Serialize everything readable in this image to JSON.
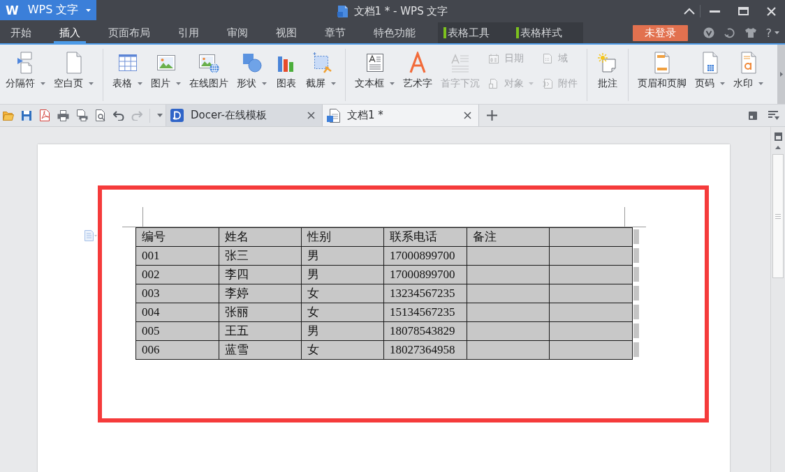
{
  "app_button": {
    "logo": "W",
    "label": "WPS 文字"
  },
  "window": {
    "title": "文档1 * - WPS 文字"
  },
  "menu_tabs": [
    {
      "label": "开始",
      "selected": false,
      "kind": "standard"
    },
    {
      "label": "插入",
      "selected": true,
      "kind": "standard"
    },
    {
      "label": "页面布局",
      "selected": false,
      "kind": "standard"
    },
    {
      "label": "引用",
      "selected": false,
      "kind": "standard"
    },
    {
      "label": "审阅",
      "selected": false,
      "kind": "standard"
    },
    {
      "label": "视图",
      "selected": false,
      "kind": "standard"
    },
    {
      "label": "章节",
      "selected": false,
      "kind": "standard"
    },
    {
      "label": "特色功能",
      "selected": false,
      "kind": "standard"
    },
    {
      "label": "表格工具",
      "selected": false,
      "kind": "context"
    },
    {
      "label": "表格样式",
      "selected": false,
      "kind": "context"
    }
  ],
  "login_button": {
    "label": "未登录"
  },
  "help_button": {
    "label": "?"
  },
  "ribbon": {
    "groups": [
      [
        {
          "label": "分隔符",
          "kind": "large",
          "dropdown": true,
          "disabled": false
        },
        {
          "label": "空白页",
          "kind": "large",
          "dropdown": true,
          "disabled": false
        }
      ],
      [
        {
          "label": "表格",
          "kind": "large",
          "dropdown": true,
          "disabled": false
        },
        {
          "label": "图片",
          "kind": "large",
          "dropdown": true,
          "disabled": false
        },
        {
          "label": "在线图片",
          "kind": "large",
          "dropdown": false,
          "disabled": false
        },
        {
          "label": "形状",
          "kind": "large",
          "dropdown": true,
          "disabled": false
        },
        {
          "label": "图表",
          "kind": "large",
          "dropdown": false,
          "disabled": false
        },
        {
          "label": "截屏",
          "kind": "large",
          "dropdown": true,
          "disabled": false
        }
      ],
      [
        {
          "label": "文本框",
          "kind": "large",
          "dropdown": true,
          "disabled": false
        },
        {
          "label": "艺术字",
          "kind": "large",
          "dropdown": false,
          "disabled": false
        },
        {
          "label": "首字下沉",
          "kind": "large",
          "dropdown": false,
          "disabled": true
        },
        {
          "label": "日期",
          "kind": "small",
          "dropdown": false,
          "disabled": true
        },
        {
          "label": "对象",
          "kind": "small",
          "dropdown": true,
          "disabled": true
        },
        {
          "label": "域",
          "kind": "small",
          "dropdown": false,
          "disabled": true
        },
        {
          "label": "附件",
          "kind": "small",
          "dropdown": false,
          "disabled": true
        }
      ],
      [
        {
          "label": "批注",
          "kind": "large",
          "dropdown": false,
          "disabled": false
        }
      ],
      [
        {
          "label": "页眉和页脚",
          "kind": "large",
          "dropdown": false,
          "disabled": false
        },
        {
          "label": "页码",
          "kind": "large",
          "dropdown": true,
          "disabled": false
        },
        {
          "label": "水印",
          "kind": "large",
          "dropdown": true,
          "disabled": false
        }
      ]
    ]
  },
  "doc_tabs": [
    {
      "label": "Docer-在线模板",
      "selected": false
    },
    {
      "label": "文档1 *",
      "selected": true
    }
  ],
  "table": {
    "selected": true,
    "columns": [
      {
        "label": "编号"
      },
      {
        "label": "姓名"
      },
      {
        "label": "性别"
      },
      {
        "label": "联系电话"
      },
      {
        "label": "备注"
      },
      {}
    ],
    "rows": [
      [
        "001",
        "张三",
        "男",
        "17000899700"
      ],
      [
        "002",
        "李四",
        "男",
        "17000899700"
      ],
      [
        "003",
        "李婷",
        "女",
        "13234567235"
      ],
      [
        "004",
        "张丽",
        "女",
        "15134567235"
      ],
      [
        "005",
        "王五",
        "男",
        "18078543829"
      ],
      [
        "006",
        "蓝雪",
        "女",
        "18027364958"
      ]
    ]
  }
}
